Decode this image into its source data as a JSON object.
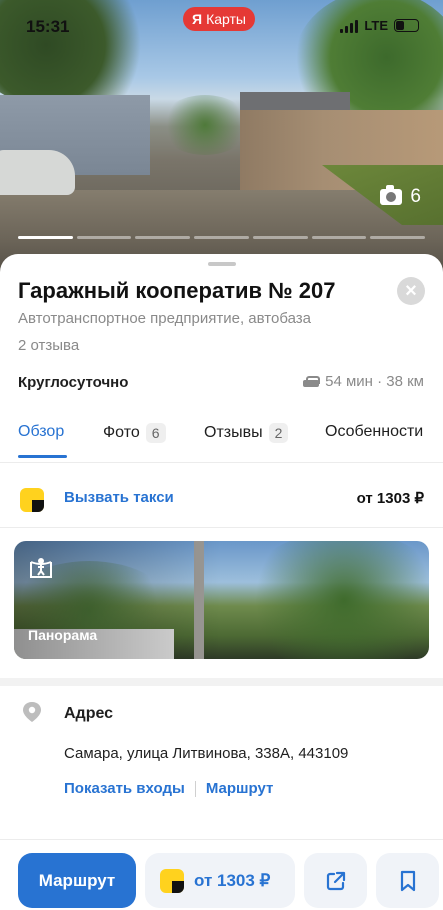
{
  "status_bar": {
    "time": "15:31",
    "network": "LTE",
    "battery": "4"
  },
  "app_badge": {
    "logo_letter": "Я",
    "label": "Карты",
    "color": "#e53935"
  },
  "photo": {
    "count": "6",
    "segments": 7,
    "active_segment": 1
  },
  "place": {
    "title": "Гаражный кооператив № 207",
    "category": "Автотранспортное предприятие, автобаза",
    "reviews": "2 отзыва",
    "hours": "Круглосуточно",
    "drive_time": "54 мин · 38 км"
  },
  "tabs": [
    {
      "label": "Обзор",
      "count": ""
    },
    {
      "label": "Фото",
      "count": "6"
    },
    {
      "label": "Отзывы",
      "count": "2"
    },
    {
      "label": "Особенности",
      "count": ""
    }
  ],
  "taxi": {
    "label": "Вызвать такси",
    "price": "от 1303 ₽"
  },
  "panorama": {
    "label": "Панорама"
  },
  "address": {
    "heading": "Адрес",
    "value": "Самара, улица Литвинова, 338А, 443109",
    "show_entrances": "Показать входы",
    "route": "Маршрут"
  },
  "bottom_bar": {
    "route_button": "Маршрут",
    "taxi_price": "от 1303 ₽"
  },
  "colors": {
    "accent": "#2873d2",
    "yandex_yellow": "#ffd21e"
  },
  "icons": [
    "camera-icon",
    "close-icon",
    "car-icon",
    "yandex-go-icon",
    "panorama-icon",
    "location-pin-icon",
    "share-icon",
    "bookmark-icon"
  ]
}
